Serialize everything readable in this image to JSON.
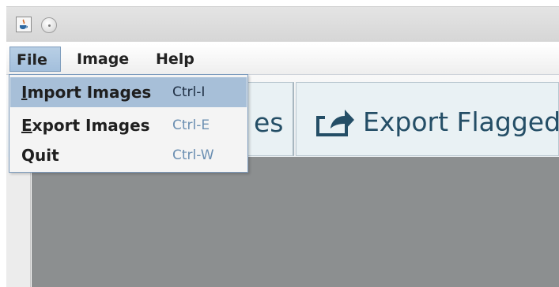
{
  "window": {
    "app_icon": "java-coffee-cup-icon",
    "control_button": "circle-button"
  },
  "menubar": {
    "items": [
      {
        "label": "File",
        "active": true
      },
      {
        "label": "Image"
      },
      {
        "label": "Help"
      }
    ]
  },
  "toolbar": {
    "buttons": [
      {
        "name": "prev-button",
        "label_visible": "es"
      },
      {
        "name": "export-flagged-button",
        "label": "Export Flagged",
        "icon": "share-arrow-icon"
      }
    ]
  },
  "file_menu": {
    "items": [
      {
        "mnemonic": "I",
        "label_rest": "mport Images",
        "shortcut": "Ctrl-I",
        "highlighted": true
      },
      {
        "mnemonic": "E",
        "label_rest": "xport Images",
        "shortcut": "Ctrl-E"
      },
      {
        "label": "Quit",
        "shortcut": "Ctrl-W"
      }
    ]
  },
  "colors": {
    "menu_highlight": "#a7bfd8",
    "toolbar_text": "#244e66",
    "canvas_bg": "#8c8f90"
  }
}
